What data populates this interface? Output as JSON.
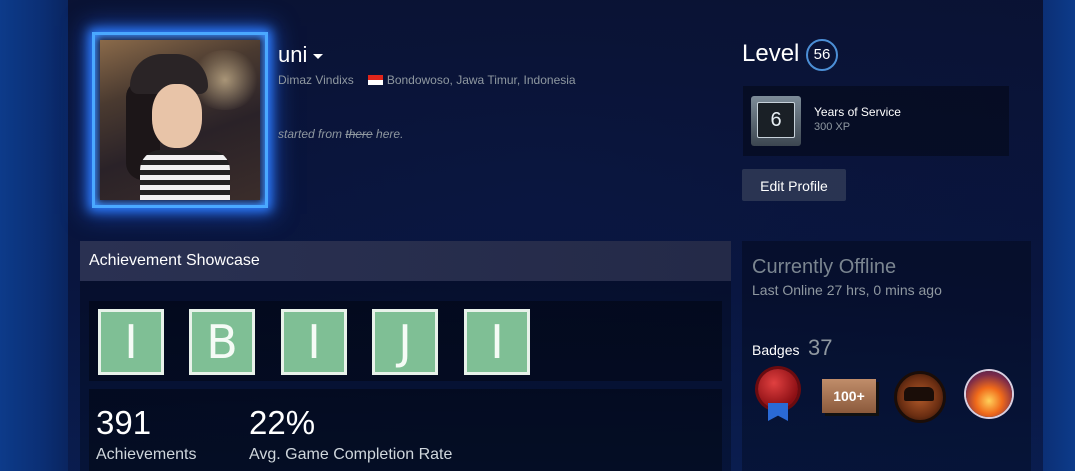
{
  "profile": {
    "persona_name": "uni",
    "real_name": "Dimaz Vindixs",
    "location": "Bondowoso, Jawa Timur, Indonesia",
    "summary_prefix": "started from ",
    "summary_strike": "there",
    "summary_suffix": " here."
  },
  "level": {
    "label": "Level",
    "value": "56"
  },
  "featured_badge": {
    "icon_value": "6",
    "title": "Years of Service",
    "xp": "300 XP"
  },
  "actions": {
    "edit_profile_label": "Edit Profile"
  },
  "showcase": {
    "title": "Achievement Showcase",
    "tiles": [
      "I",
      "B",
      "I",
      "J",
      "I"
    ],
    "stats": [
      {
        "value": "391",
        "label": "Achievements"
      },
      {
        "value": "22%",
        "label": "Avg. Game Completion Rate"
      }
    ]
  },
  "status": {
    "title": "Currently Offline",
    "last_online": "Last Online 27 hrs, 0 mins ago"
  },
  "badges": {
    "label": "Badges",
    "count": "37",
    "icons": [
      "wax-seal-ribbon-badge",
      "100-plus-badge",
      "car-disc-badge",
      "fire-orb-badge"
    ],
    "badge2_text": "100+"
  },
  "colors": {
    "accent_blue": "#4aa8ff",
    "tile_green": "#7fbf95",
    "indonesia_flag_red": "#e1251b"
  }
}
